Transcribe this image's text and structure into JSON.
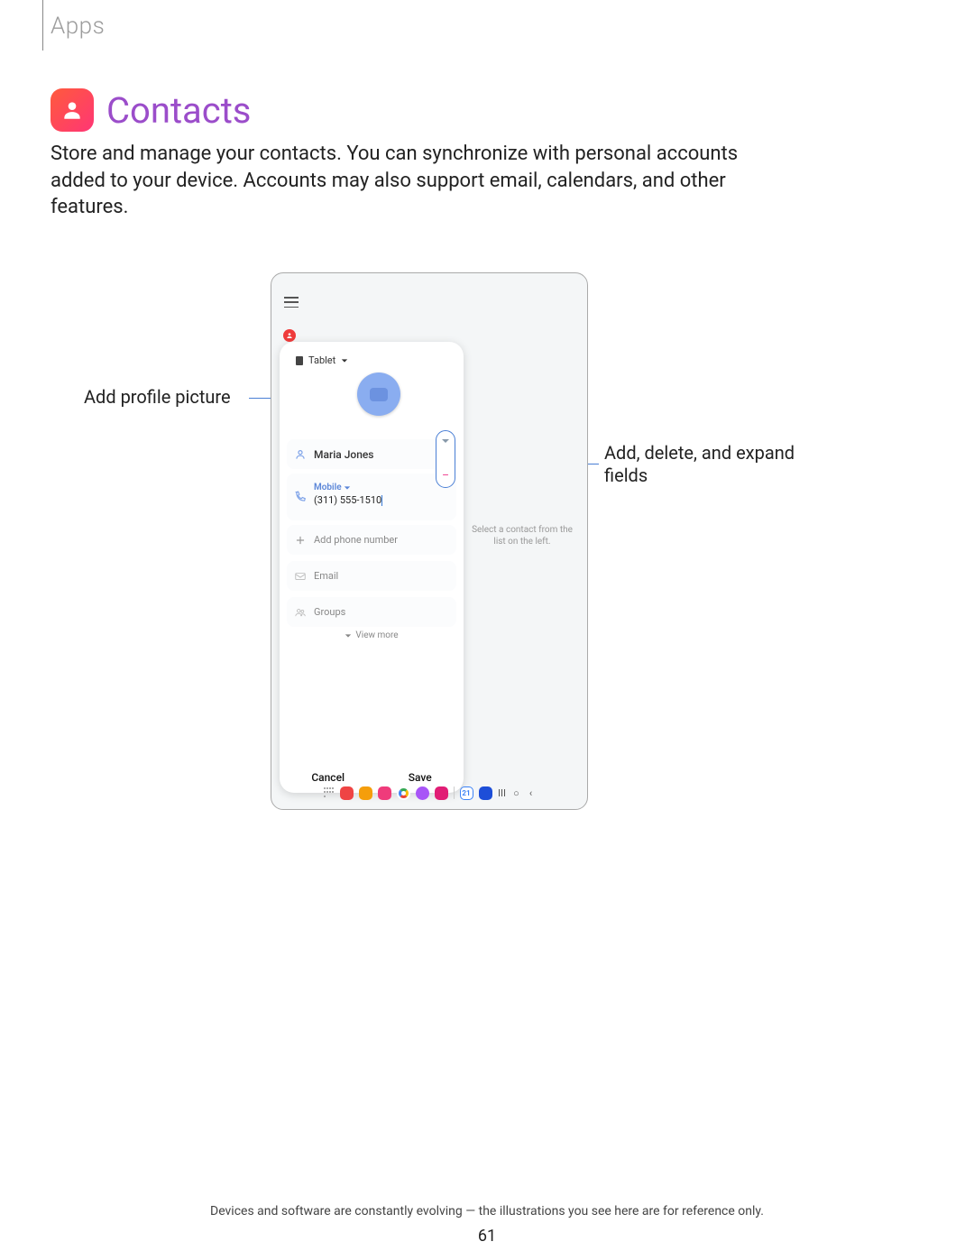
{
  "breadcrumb": "Apps",
  "title": "Contacts",
  "description": "Store and manage your contacts. You can synchronize with personal accounts added to your device. Accounts may also support email, calendars, and other features.",
  "callouts": {
    "left": "Add profile picture",
    "right": "Add, delete, and expand fields"
  },
  "device": {
    "storage_label": "Tablet",
    "name_field": "Maria Jones",
    "phone_type": "Mobile",
    "phone_number": "(311) 555-1510",
    "add_phone": "Add phone number",
    "email": "Email",
    "groups": "Groups",
    "view_more": "View more",
    "cancel": "Cancel",
    "save": "Save",
    "right_pane_hint": "Select a contact from the list on the left.",
    "taskbar_date": "21"
  },
  "footer_note": "Devices and software are constantly evolving — the illustrations you see here are for reference only.",
  "page_number": "61"
}
